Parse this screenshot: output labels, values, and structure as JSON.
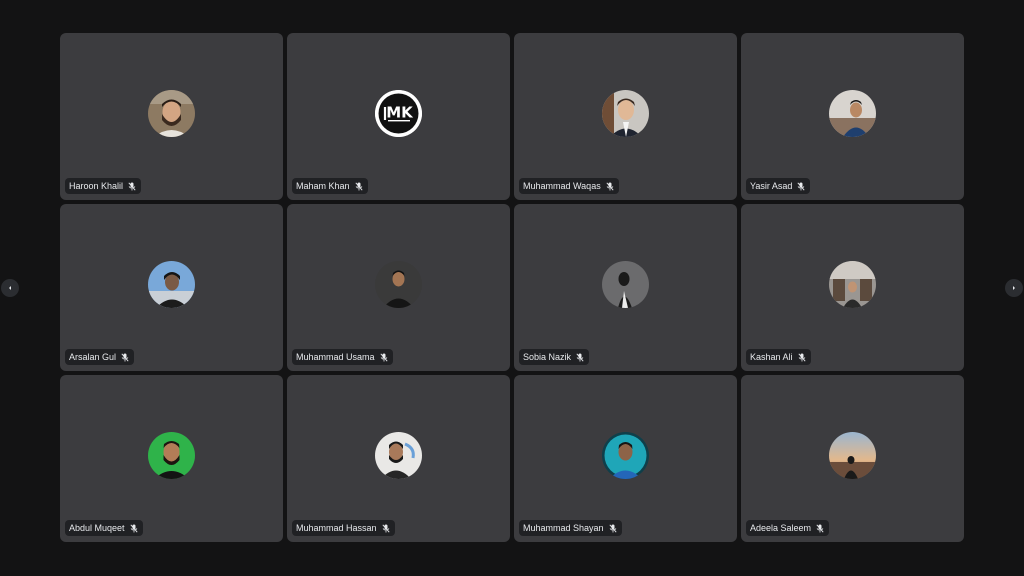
{
  "colors": {
    "background": "#131314",
    "tile": "#3c3c3f",
    "name_tag_bg": "#202124",
    "name_text": "#e8eaed"
  },
  "participants": [
    {
      "name": "Haroon Khalil",
      "avatar_icon": "user-photo-avatar",
      "muted": true
    },
    {
      "name": "Maham Khan",
      "avatar_icon": "mk-logo-avatar",
      "muted": true,
      "logo_text": "MK"
    },
    {
      "name": "Muhammad Waqas",
      "avatar_icon": "user-photo-avatar",
      "muted": true
    },
    {
      "name": "Yasir Asad",
      "avatar_icon": "user-photo-avatar",
      "muted": true
    },
    {
      "name": "Arsalan Gul",
      "avatar_icon": "user-photo-avatar",
      "muted": true
    },
    {
      "name": "Muhammad Usama",
      "avatar_icon": "user-photo-avatar",
      "muted": true
    },
    {
      "name": "Sobia Nazik",
      "avatar_icon": "user-photo-avatar",
      "muted": true
    },
    {
      "name": "Kashan Ali",
      "avatar_icon": "user-photo-avatar",
      "muted": true
    },
    {
      "name": "Abdul Muqeet",
      "avatar_icon": "user-photo-avatar",
      "muted": true
    },
    {
      "name": "Muhammad Hassan",
      "avatar_icon": "user-photo-avatar",
      "muted": true
    },
    {
      "name": "Muhammad Shayan",
      "avatar_icon": "user-photo-avatar",
      "muted": true
    },
    {
      "name": "Adeela Saleem",
      "avatar_icon": "user-photo-avatar",
      "muted": true
    }
  ],
  "navigation": {
    "prev_icon": "chevron-left-icon",
    "next_icon": "chevron-right-icon"
  }
}
